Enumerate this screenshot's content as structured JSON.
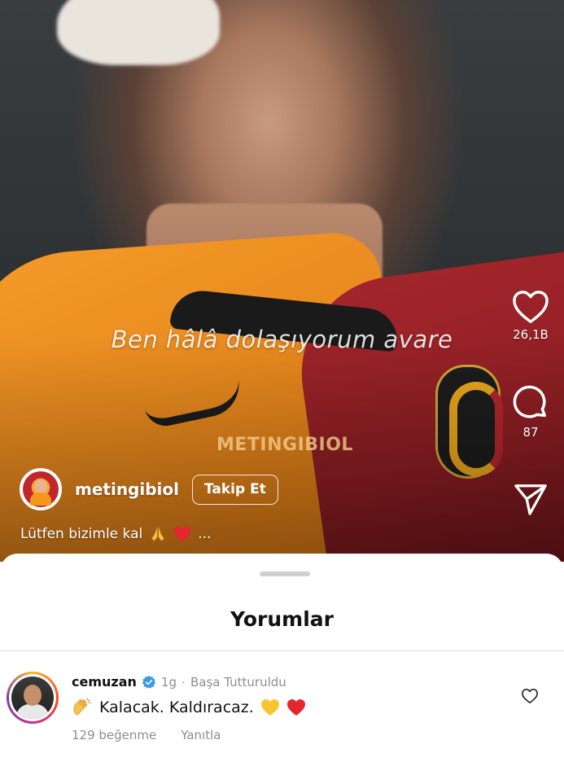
{
  "reel": {
    "lyric": "Ben hâlâ dolaşıyorum avare",
    "watermark": "METINGIBIOL",
    "author": "metingibiol",
    "follow_label": "Takip Et",
    "caption": "Lütfen bizimle kal",
    "caption_more": "...",
    "like_count": "26,1B",
    "comment_count": "87"
  },
  "comments_sheet": {
    "title": "Yorumlar",
    "comments": [
      {
        "username": "cemuzan",
        "verified": true,
        "time": "1g",
        "pinned_label": "Başa Tutturuldu",
        "text": "Kalacak. Kaldıracaz.",
        "likes_label": "129 beğenme",
        "reply_label": "Yanıtla"
      }
    ]
  },
  "icons": [
    "heart-icon",
    "comment-icon",
    "share-icon",
    "verified-badge-icon",
    "clapping-hands-emoji",
    "folded-hands-emoji",
    "red-heart-emoji",
    "yellow-heart-emoji"
  ],
  "colors": {
    "accent_orange": "#f39a1e",
    "accent_red": "#a5262c",
    "verified_blue": "#3897f0",
    "muted_text": "#8e8e8e"
  }
}
